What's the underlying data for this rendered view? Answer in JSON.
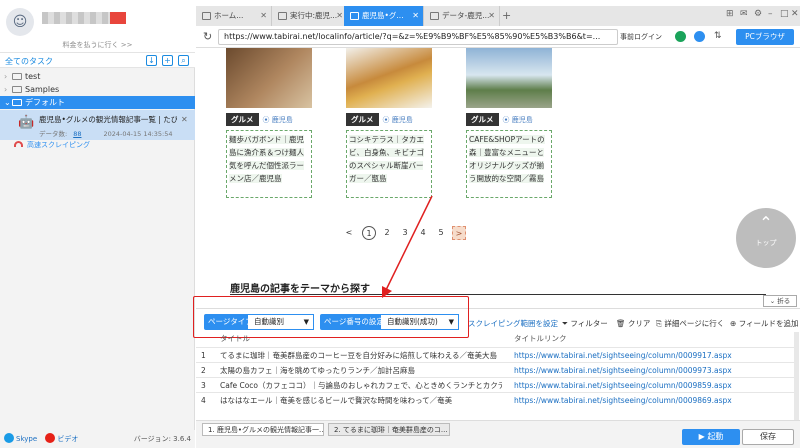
{
  "sidebar": {
    "upgrade_link": "料金を払うに行く >>",
    "task_title": "全てのタスク",
    "folders": [
      {
        "label": "test"
      },
      {
        "label": "Samples"
      },
      {
        "label": "デフォルト"
      }
    ],
    "task": {
      "name": "鹿児島•グルメの観光情報記事一覧 | たびら...",
      "count_label": "データ数:",
      "count": "88",
      "date": "2024-04-15 14:35:54"
    },
    "cloud_label": "高速スクレイピング",
    "skype_label": "Skype",
    "video_label": "ビデオ",
    "version": "バージョン: 3.6.4"
  },
  "browser": {
    "tabs": [
      {
        "label": "ホーム..."
      },
      {
        "label": "実行中:鹿児..."
      },
      {
        "label": "鹿児島•グ..."
      },
      {
        "label": "データ-鹿児..."
      }
    ],
    "url": "https://www.tabirai.net/localinfo/article/?q=&z=%E9%B9%BF%E5%85%90%E5%B3%B6&t=...",
    "preload_label": "事前ログイン",
    "pc_browser_label": "PCブラウザ"
  },
  "page": {
    "cards": [
      {
        "badge": "グルメ",
        "location": "鹿児島",
        "desc": "麺歩バガボンド｜鹿児島に漁介系＆つけ麺人気を呼んだ個性派ラーメン店／鹿児島"
      },
      {
        "badge": "グルメ",
        "location": "鹿児島",
        "desc": "コシキテラス｜タカエビ、白身魚、キビナゴのスペシャル断崖バーガー／甑島"
      },
      {
        "badge": "グルメ",
        "location": "鹿児島",
        "desc": "CAFE&SHOPアートの森｜豊富なメニューとオリジナルグッズが揃う開放的な空間／霧島"
      }
    ],
    "pager": {
      "prev": "<",
      "pages": [
        "1",
        "2",
        "3",
        "4",
        "5"
      ],
      "next": ">"
    },
    "scroll_top_label": "トップ",
    "section_title": "鹿児島の記事をテーマから探す",
    "collapse_label": "折る"
  },
  "toolbar": {
    "page_type_label": "ページタイプ",
    "page_type_value": "自動識別",
    "page_number_label": "ページ番号の設定",
    "page_number_value": "自動識別(成功)",
    "scroll_setting": "スクレイピング範囲を設定",
    "filter": "フィルター",
    "clear": "クリア",
    "detail": "詳細ページに行く",
    "add_field": "フィールドを追加"
  },
  "table": {
    "columns": [
      "タイトル",
      "タイトルリンク"
    ],
    "rows": [
      {
        "n": "1",
        "title": "てるまに珈琲｜奄美群島産のコーヒー豆を自分好みに焙煎して味わえる／奄美大島",
        "link": "https://www.tabirai.net/sightseeing/column/0009917.aspx"
      },
      {
        "n": "2",
        "title": "太陽の島カフェ｜海を眺めてゆったりランチ／加計呂麻島",
        "link": "https://www.tabirai.net/sightseeing/column/0009973.aspx"
      },
      {
        "n": "3",
        "title": "Cafe Coco（カフェココ）｜与論島のおしゃれカフェで、心ときめくランチとカクテルを／与...",
        "link": "https://www.tabirai.net/sightseeing/column/0009859.aspx"
      },
      {
        "n": "4",
        "title": "はなはなエール｜奄美を感じるビールで贅沢な時間を味わって／奄美",
        "link": "https://www.tabirai.net/sightseeing/column/0009869.aspx"
      }
    ]
  },
  "bottom": {
    "tabs": [
      {
        "label": "1. 鹿児島•グルメの観光情報記事一..."
      },
      {
        "label": "2. てるまに珈琲｜奄美群島産のコ..."
      }
    ],
    "start_label": "起動",
    "save_label": "保存"
  },
  "colors": {
    "accent": "#2d8ff0",
    "highlight": "#e02020"
  }
}
